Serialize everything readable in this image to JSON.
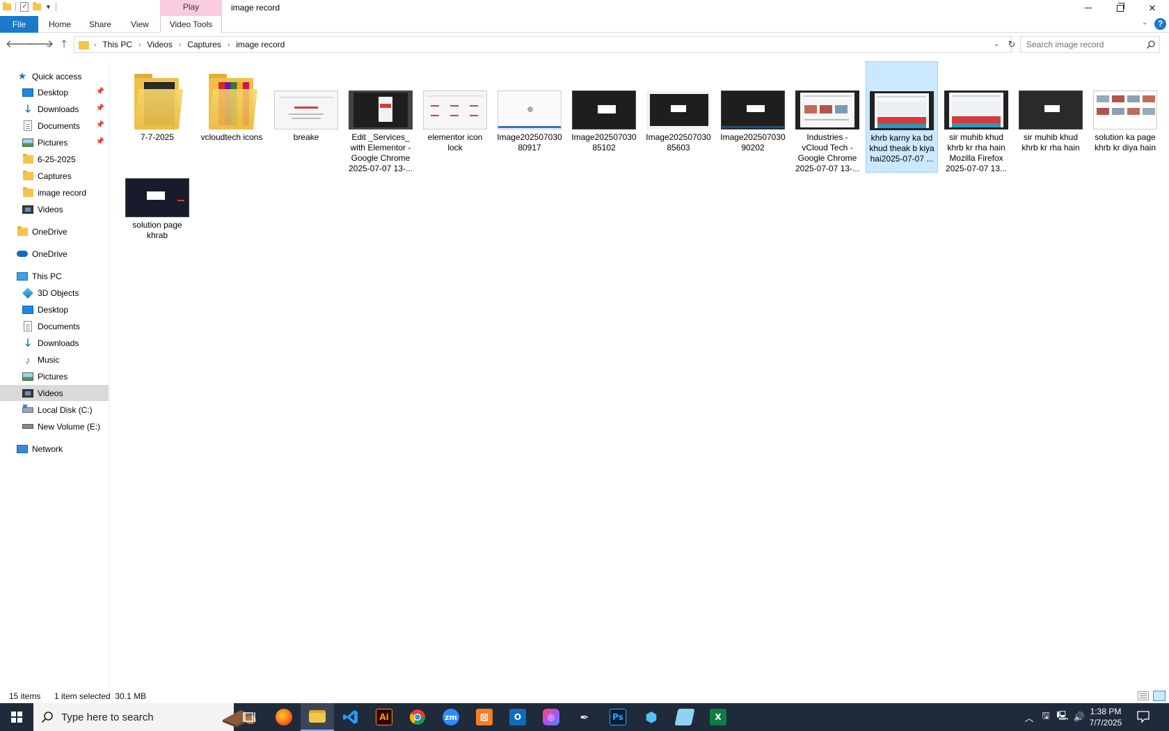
{
  "window": {
    "title": "image record",
    "context_tab_header": "Play"
  },
  "ribbon": {
    "tabs": [
      "File",
      "Home",
      "Share",
      "View",
      "Video Tools"
    ]
  },
  "address": {
    "crumbs": [
      "This PC",
      "Videos",
      "Captures",
      "image record"
    ]
  },
  "search": {
    "placeholder": "Search image record"
  },
  "sidebar": {
    "items": [
      {
        "label": "Quick access",
        "icon": "star-icon",
        "pinned": false
      },
      {
        "label": "Desktop",
        "icon": "desktop-icon",
        "pinned": true
      },
      {
        "label": "Downloads",
        "icon": "download-icon",
        "pinned": true
      },
      {
        "label": "Documents",
        "icon": "documents-icon",
        "pinned": true
      },
      {
        "label": "Pictures",
        "icon": "pictures-icon",
        "pinned": true
      },
      {
        "label": "6-25-2025",
        "icon": "folder-icon",
        "pinned": false
      },
      {
        "label": "Captures",
        "icon": "folder-icon",
        "pinned": false
      },
      {
        "label": "image record",
        "icon": "folder-icon",
        "pinned": false
      },
      {
        "label": "Videos",
        "icon": "videos-icon",
        "pinned": false
      },
      {
        "label": "OneDrive",
        "icon": "folder-icon",
        "pinned": false
      },
      {
        "label": "OneDrive",
        "icon": "onedrive-cloud-icon",
        "pinned": false
      },
      {
        "label": "This PC",
        "icon": "computer-icon",
        "pinned": false
      },
      {
        "label": "3D Objects",
        "icon": "3d-objects-icon",
        "pinned": false
      },
      {
        "label": "Desktop",
        "icon": "desktop-icon",
        "pinned": false
      },
      {
        "label": "Documents",
        "icon": "documents-icon",
        "pinned": false
      },
      {
        "label": "Downloads",
        "icon": "download-icon",
        "pinned": false
      },
      {
        "label": "Music",
        "icon": "music-icon",
        "pinned": false
      },
      {
        "label": "Pictures",
        "icon": "pictures-icon",
        "pinned": false
      },
      {
        "label": "Videos",
        "icon": "videos-icon",
        "pinned": false,
        "selected": true
      },
      {
        "label": "Local Disk (C:)",
        "icon": "local-disk-icon",
        "pinned": false
      },
      {
        "label": "New Volume (E:)",
        "icon": "drive-icon",
        "pinned": false
      },
      {
        "label": "Network",
        "icon": "network-icon",
        "pinned": false
      }
    ]
  },
  "files": [
    {
      "name": "7-7-2025",
      "kind": "folder"
    },
    {
      "name": "vcloudtech icons",
      "kind": "folder"
    },
    {
      "name": "breake",
      "kind": "image"
    },
    {
      "name": "Edit _Services_ with Elementor - Google Chrome 2025-07-07 13-...",
      "kind": "video"
    },
    {
      "name": "elementor icon lock",
      "kind": "image"
    },
    {
      "name": "Image20250703080917",
      "kind": "image"
    },
    {
      "name": "Image20250703085102",
      "kind": "image"
    },
    {
      "name": "Image20250703085603",
      "kind": "image"
    },
    {
      "name": "Image20250703090202",
      "kind": "image"
    },
    {
      "name": "Industries - vCloud Tech - Google Chrome 2025-07-07 13-...",
      "kind": "video"
    },
    {
      "name": "khrb karny ka bd khud theak b kiya hai2025-07-07 ...",
      "kind": "video",
      "selected": true
    },
    {
      "name": "sir muhib khud khrb kr rha hain Mozilla Firefox 2025-07-07 13...",
      "kind": "video"
    },
    {
      "name": "sir muhib khud khrb kr rha hain",
      "kind": "image"
    },
    {
      "name": "solution ka page khrb kr diya hain",
      "kind": "image"
    },
    {
      "name": "solution page khrab",
      "kind": "image"
    }
  ],
  "status": {
    "count": "15 items",
    "selection": "1 item selected  30.1 MB"
  },
  "taskbar": {
    "search_text": "Type here to search",
    "apps": [
      "firefox-icon",
      "file-explorer-icon",
      "vscode-icon",
      "illustrator-icon",
      "chrome-icon",
      "zoom-icon",
      "xampp-icon",
      "outlook-icon",
      "creative-cloud-icon",
      "pen-tool-icon",
      "photoshop-icon",
      "app-icon",
      "notepad-icon",
      "excel-icon"
    ],
    "time": "1:38 PM",
    "date": "7/7/2025"
  }
}
